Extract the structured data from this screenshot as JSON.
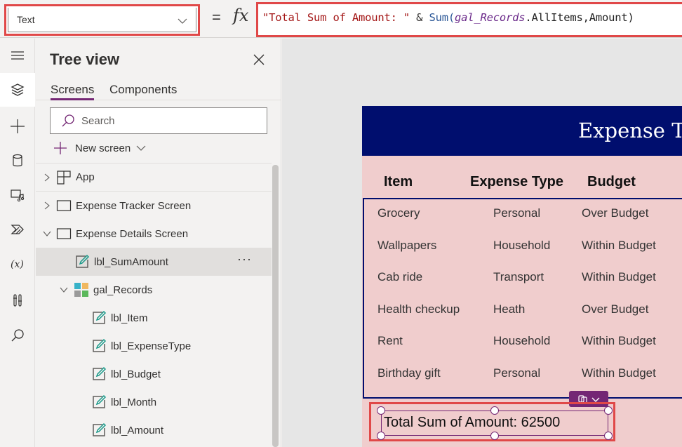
{
  "formula_bar": {
    "property": "Text",
    "equals": "=",
    "fx": "fx",
    "formula": {
      "string_literal": "\"Total Sum of Amount: \"",
      "operator": " & ",
      "function": "Sum(",
      "gallery_ref": "gal_Records",
      "rest": ".AllItems,Amount)"
    }
  },
  "rail": {
    "items": [
      {
        "icon": "hamburger-menu-icon"
      },
      {
        "icon": "layers-icon",
        "active": true
      },
      {
        "icon": "plus-icon"
      },
      {
        "icon": "database-icon"
      },
      {
        "icon": "media-icon"
      },
      {
        "icon": "power-automate-icon"
      },
      {
        "icon": "variables-icon",
        "label": "(x)"
      },
      {
        "icon": "advanced-tools-icon"
      },
      {
        "icon": "search-icon"
      }
    ]
  },
  "tree_view": {
    "title": "Tree view",
    "tabs": [
      {
        "label": "Screens",
        "active": true
      },
      {
        "label": "Components",
        "active": false
      }
    ],
    "search_placeholder": "Search",
    "new_screen_label": "New screen",
    "items": [
      {
        "label": "App",
        "icon": "app-icon",
        "chevron": "right"
      },
      {
        "label": "Expense Tracker Screen",
        "icon": "screen-icon",
        "chevron": "right"
      },
      {
        "label": "Expense Details Screen",
        "icon": "screen-icon",
        "chevron": "down"
      },
      {
        "label": "lbl_SumAmount",
        "icon": "label-icon",
        "selected": true,
        "more": "···"
      },
      {
        "label": "gal_Records",
        "icon": "gallery-icon",
        "chevron": "down"
      },
      {
        "label": "lbl_Item",
        "icon": "label-icon"
      },
      {
        "label": "lbl_ExpenseType",
        "icon": "label-icon"
      },
      {
        "label": "lbl_Budget",
        "icon": "label-icon"
      },
      {
        "label": "lbl_Month",
        "icon": "label-icon"
      },
      {
        "label": "lbl_Amount",
        "icon": "label-icon"
      }
    ]
  },
  "canvas": {
    "app_title": "Expense Tracker",
    "columns": [
      "Item",
      "Expense Type",
      "Budget"
    ],
    "rows": [
      {
        "item": "Grocery",
        "type": "Personal",
        "budget": "Over Budget"
      },
      {
        "item": "Wallpapers",
        "type": "Household",
        "budget": "Within Budget"
      },
      {
        "item": "Cab ride",
        "type": "Transport",
        "budget": "Within Budget"
      },
      {
        "item": "Health checkup",
        "type": "Heath",
        "budget": "Over Budget"
      },
      {
        "item": "Rent",
        "type": "Household",
        "budget": "Within Budget"
      },
      {
        "item": "Birthday gift",
        "type": "Personal",
        "budget": "Within Budget"
      }
    ],
    "sum_label": "Total Sum of Amount: 62500"
  },
  "colors": {
    "accent": "#742774",
    "highlight_red": "#e04848",
    "header_navy": "#000e6e",
    "screen_pink": "#f0cdcd"
  }
}
